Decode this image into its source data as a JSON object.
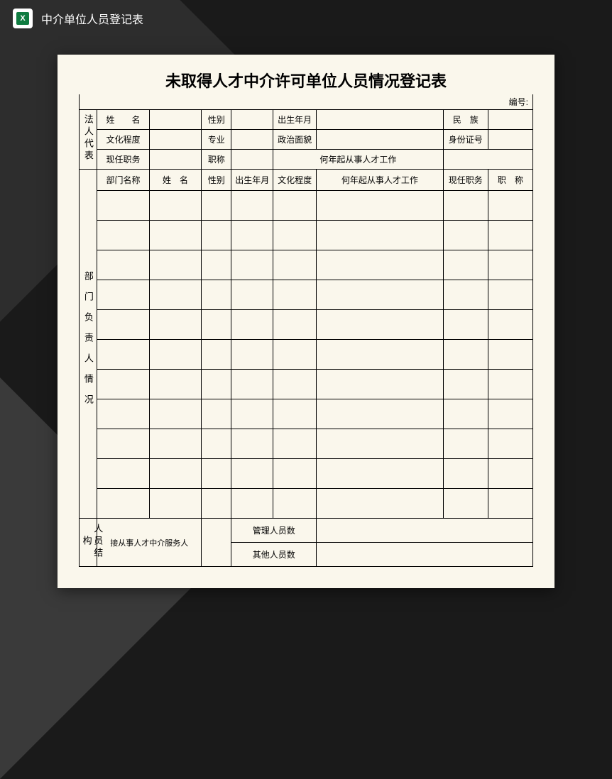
{
  "header": {
    "title": "中介单位人员登记表",
    "iconText": "X"
  },
  "document": {
    "title": "未取得人才中介许可单位人员情况登记表",
    "bianhao_label": "编号:",
    "legal_rep": {
      "section_label": "法人代表",
      "name_label": "姓　　名",
      "gender_label": "性别",
      "birth_label": "出生年月",
      "ethnicity_label": "民　族",
      "education_label": "文化程度",
      "major_label": "专业",
      "political_label": "政治面貌",
      "id_label": "身份证号",
      "position_label": "现任职务",
      "title_label": "职称",
      "since_label": "何年起从事人才工作"
    },
    "dept": {
      "section_label": "部门负责人情况",
      "col_dept": "部门名称",
      "col_name": "姓　名",
      "col_gender": "性别",
      "col_birth": "出生年月",
      "col_edu": "文化程度",
      "col_since": "何年起从事人才工作",
      "col_position": "现任职务",
      "col_title": "职　称"
    },
    "structure": {
      "section_label": "人员结构",
      "total_label": "接从事人才中介服务人",
      "mgmt_label": "管理人员数",
      "other_label": "其他人员数"
    }
  }
}
